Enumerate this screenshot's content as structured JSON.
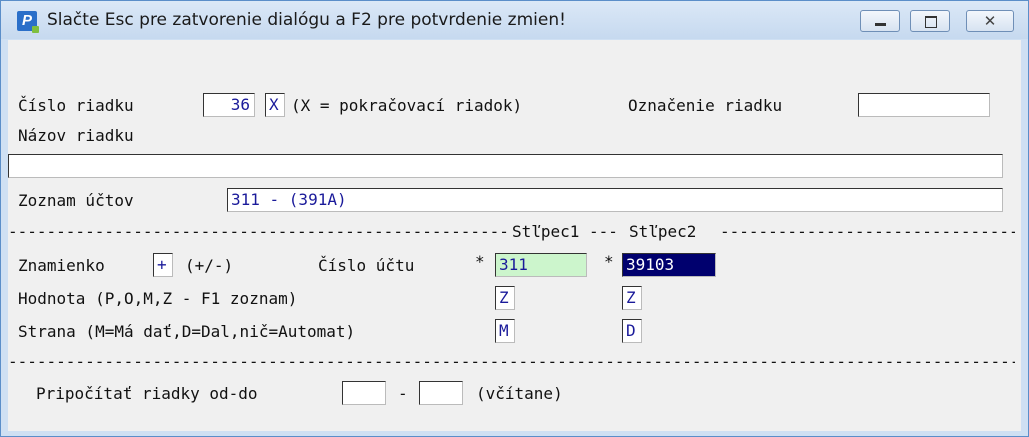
{
  "window": {
    "title": "Slačte Esc pre zatvorenie dialógu a F2 pre potvrdenie zmien!"
  },
  "form": {
    "row_number_label": "Číslo riadku",
    "row_number_value": "36",
    "continuation_value": "X",
    "continuation_hint": "(X = pokračovací riadok)",
    "row_mark_label": "Označenie riadku",
    "row_mark_value": "",
    "row_name_label": "Názov riadku",
    "row_name_value": "",
    "accounts_label": "Zoznam účtov",
    "accounts_value": "311 - (391A)",
    "column1_label": "Stľpec1",
    "column2_label": "Stľpec2",
    "sign_label": "Znamienko",
    "sign_value": "+",
    "sign_hint": "(+/-)",
    "account_number_label": "Číslo účtu",
    "asterisk": "*",
    "col1_account": "311",
    "col2_account": "39103",
    "value_label": "Hodnota (P,O,M,Z - F1 zoznam)",
    "col1_value": "Z",
    "col2_value": "Z",
    "side_label": "Strana (M=Má dať,D=Dal,nič=Automat)",
    "col1_side": "M",
    "col2_side": "D",
    "sum_rows_label": "Pripočítať riadky od-do",
    "sum_from": "",
    "range_dash": "-",
    "sum_to": "",
    "inclusive_label": "(včítane)"
  },
  "divider": "------------------------------------------------------------------------------------------------------------------------------------------"
}
